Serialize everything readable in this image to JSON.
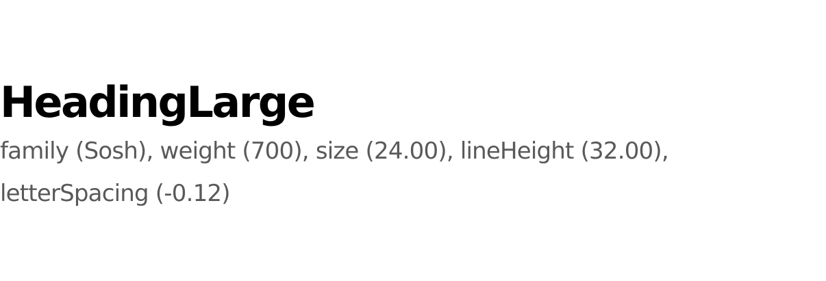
{
  "token": {
    "name": "HeadingLarge",
    "description": "family (Sosh), weight (700), size (24.00), lineHeight (32.00), letterSpacing (-0.12)"
  },
  "colors": {
    "title": "#000000",
    "description": "#595959",
    "background": "#ffffff"
  }
}
